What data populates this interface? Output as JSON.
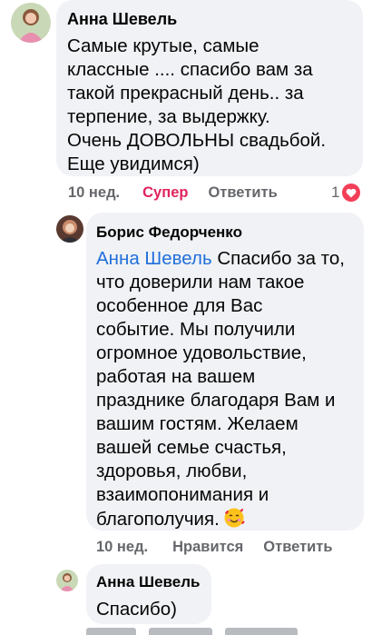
{
  "comments": [
    {
      "author": "Анна Шевель",
      "lines": [
        "Самые крутые, самые",
        "классные .... спасибо вам за",
        "такой прекрасный день.. за",
        "терпение, за выдержку.",
        "Очень ДОВОЛЬНЫ свадьбой.",
        "Еще увидимся)"
      ],
      "time": "10 нед.",
      "reaction_label": "Супер",
      "reply_label": "Ответить",
      "reaction_count": "1",
      "reaction_icon": "heart-icon"
    },
    {
      "author": "Борис Федорченко",
      "mention": "Анна Шевель",
      "first_line_rest": "Спасибо за то,",
      "lines": [
        "что доверили нам такое",
        "особенное для Вас",
        "событие. Мы получили",
        "огромное удовольствие,",
        "работая на вашем",
        "празднике благодаря Вам и",
        "вашим гостям. Желаем",
        "вашей семье счастья,",
        "здоровья, любви,",
        "взаимопонимания и"
      ],
      "last_line": "благополучия.",
      "emoji": "smiling-face-with-hearts-icon",
      "time": "10 нед.",
      "like_label": "Нравится",
      "reply_label": "Ответить"
    },
    {
      "author": "Анна Шевель",
      "text": "Спасибо)"
    }
  ],
  "colors": {
    "bubble": "#f0f2f5",
    "mention": "#216fdb",
    "meta": "#65676b",
    "reacted": "#e0245e",
    "heart": "#f33e58"
  }
}
